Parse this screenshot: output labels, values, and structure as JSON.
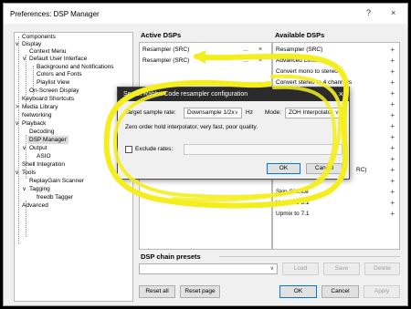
{
  "window": {
    "title": "Preferences: DSP Manager",
    "help_glyph": "?",
    "close_glyph": "×"
  },
  "tree": {
    "items": [
      {
        "label": "Components"
      },
      {
        "label": "Display"
      },
      {
        "label": "Context Menu"
      },
      {
        "label": "Default User Interface"
      },
      {
        "label": "Background and Notifications"
      },
      {
        "label": "Colors and Fonts"
      },
      {
        "label": "Playlist View"
      },
      {
        "label": "On-Screen Display"
      },
      {
        "label": "Keyboard Shortcuts"
      },
      {
        "label": "Media Library"
      },
      {
        "label": "Networking"
      },
      {
        "label": "Playback"
      },
      {
        "label": "Decoding"
      },
      {
        "label": "DSP Manager"
      },
      {
        "label": "Output"
      },
      {
        "label": "ASIO"
      },
      {
        "label": "Shell Integration"
      },
      {
        "label": "Tools"
      },
      {
        "label": "ReplayGain Scanner"
      },
      {
        "label": "Tagging"
      },
      {
        "label": "freedb Tagger"
      },
      {
        "label": "Advanced"
      }
    ],
    "expanders": {
      "collapsed": ">",
      "expanded": "v",
      "minus": "-"
    }
  },
  "active": {
    "label": "Active DSPs",
    "rows": [
      {
        "label": "Resampler (SRC)",
        "config": "...",
        "remove": "×"
      },
      {
        "label": "Resampler (SRC)",
        "config": "...",
        "remove": "×"
      }
    ]
  },
  "available": {
    "label": "Available DSPs",
    "add_glyph": "+",
    "rows": [
      {
        "label": "Resampler (SRC)"
      },
      {
        "label": "Advanced Limiter"
      },
      {
        "label": "Convert mono to stereo"
      },
      {
        "label": "Convert stereo to 4 channels"
      },
      {
        "label": ""
      },
      {
        "label": ""
      },
      {
        "label": ""
      },
      {
        "label": ""
      },
      {
        "label": ""
      },
      {
        "label": ""
      },
      {
        "label": ""
      },
      {
        "label": "RC)"
      },
      {
        "label": ""
      },
      {
        "label": "Skip Silence"
      },
      {
        "label": "Upmix to 5.1"
      },
      {
        "label": "Upmix to 7.1"
      }
    ]
  },
  "presets": {
    "label": "DSP chain presets",
    "combo_value": "",
    "combo_arrow": "∨",
    "load": "Load",
    "save": "Save",
    "delete": "Delete"
  },
  "footer": {
    "reset_all": "Reset all",
    "reset_page": "Reset page",
    "ok": "OK",
    "cancel": "Cancel",
    "apply": "Apply"
  },
  "dialog": {
    "title": "Secret Rabbit Code resampler configuration",
    "close": "×",
    "rate_label": "Target sample rate:",
    "rate_value": "Downsample 1/2x",
    "rate_unit": "Hz",
    "mode_label": "Mode:",
    "mode_value": "ZOH Interpolator",
    "combo_arrow": "∨",
    "description": "Zero order hold interpolator, very fast, poor quality.",
    "exclude_label": "Exclude rates:",
    "exclude_value": "",
    "ok": "OK",
    "cancel": "Cancel"
  },
  "colors": {
    "highlight": "#f5ee1f",
    "selection": "#dcdcdc",
    "dialog_title_bg": "#2b2b2b",
    "accent": "#0078d7"
  }
}
